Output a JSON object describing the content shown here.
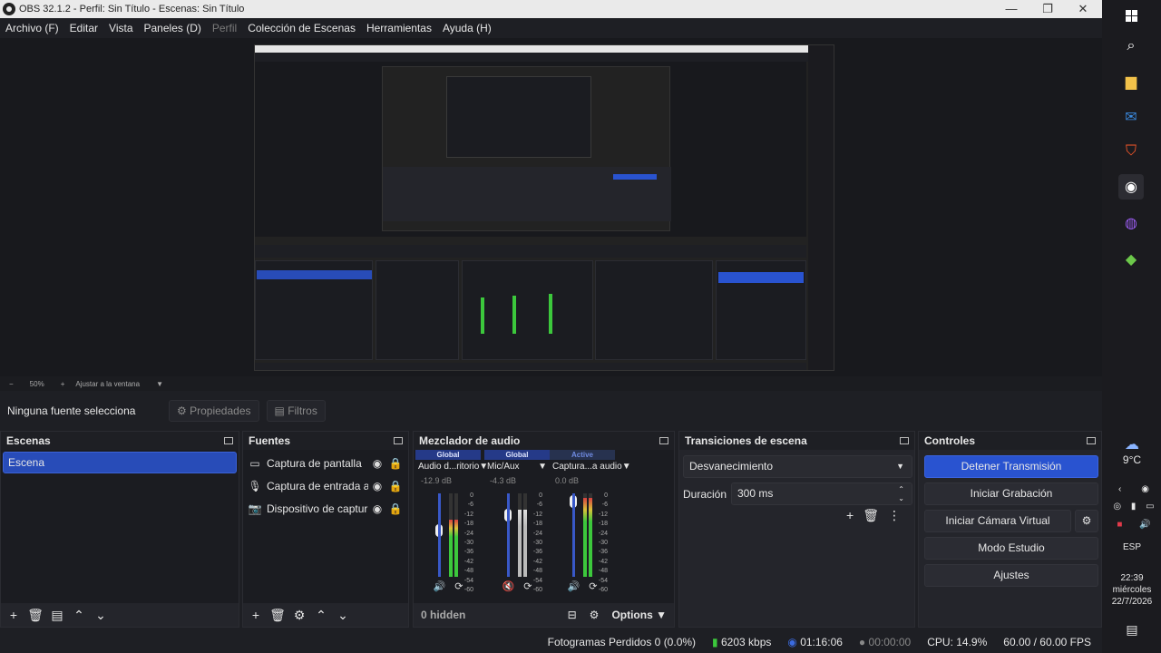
{
  "window": {
    "title": "OBS 32.1.2 - Perfil: Sin Título - Escenas: Sin Título",
    "minimize": "—",
    "maximize": "❐",
    "close": "✕"
  },
  "menu": [
    {
      "label": "Archivo (F)",
      "disabled": false
    },
    {
      "label": "Editar",
      "disabled": false
    },
    {
      "label": "Vista",
      "disabled": false
    },
    {
      "label": "Paneles (D)",
      "disabled": false
    },
    {
      "label": "Perfil",
      "disabled": true
    },
    {
      "label": "Colección de Escenas",
      "disabled": false
    },
    {
      "label": "Herramientas",
      "disabled": false
    },
    {
      "label": "Ayuda (H)",
      "disabled": false
    }
  ],
  "zoom": {
    "minus": "−",
    "value": "50%",
    "plus": "+",
    "fit": "Ajustar a la ventana"
  },
  "source_bar": {
    "no_selection": "Ninguna fuente selecciona",
    "properties": "Propiedades",
    "filters": "Filtros"
  },
  "scenes": {
    "title": "Escenas",
    "items": [
      "Escena"
    ]
  },
  "sources": {
    "title": "Fuentes",
    "items": [
      {
        "name": "Captura de pantalla",
        "icon": "monitor-icon"
      },
      {
        "name": "Captura de entrada a",
        "icon": "microphone-icon"
      },
      {
        "name": "Dispositivo de captur",
        "icon": "camera-icon"
      }
    ]
  },
  "mixer": {
    "title": "Mezclador de audio",
    "channels": [
      {
        "header": "Global",
        "name": "Audio d...ritorio",
        "db": "-12.9 dB",
        "active": false,
        "level": 0.68,
        "muted": false
      },
      {
        "header": "Global",
        "name": "Mic/Aux",
        "db": "-4.3 dB",
        "active": false,
        "level": 0.8,
        "muted": true
      },
      {
        "header": "Active",
        "name": "Captura...a audio",
        "db": "0.0 dB",
        "active": true,
        "level": 0.95,
        "muted": false
      }
    ],
    "scale": [
      "0",
      "-6",
      "-12",
      "-18",
      "-24",
      "-30",
      "-36",
      "-42",
      "-48",
      "-54",
      "-60"
    ],
    "hidden": "0 hidden",
    "options": "Options"
  },
  "transitions": {
    "title": "Transiciones de escena",
    "selected": "Desvanecimiento",
    "duration_label": "Duración",
    "duration_value": "300 ms"
  },
  "controls": {
    "title": "Controles",
    "stop_stream": "Detener Transmisión",
    "start_recording": "Iniciar Grabación",
    "start_virtual_cam": "Iniciar Cámara Virtual",
    "studio_mode": "Modo Estudio",
    "settings": "Ajustes"
  },
  "status": {
    "dropped": "Fotogramas Perdidos 0 (0.0%)",
    "bitrate": "6203 kbps",
    "stream_time": "01:16:06",
    "rec_time": "00:00:00",
    "cpu": "CPU: 14.9%",
    "fps": "60.00 / 60.00 FPS"
  },
  "taskbar": {
    "weather": "9°C",
    "lang": "ESP",
    "time": "22:39",
    "day": "miércoles",
    "date": "22/7/2026"
  },
  "colors": {
    "accent": "#2953d0",
    "scene_selected": "#284cb8",
    "meter_green": "#3cc83c",
    "meter_yellow": "#d8c23a",
    "meter_red": "#d84040"
  }
}
